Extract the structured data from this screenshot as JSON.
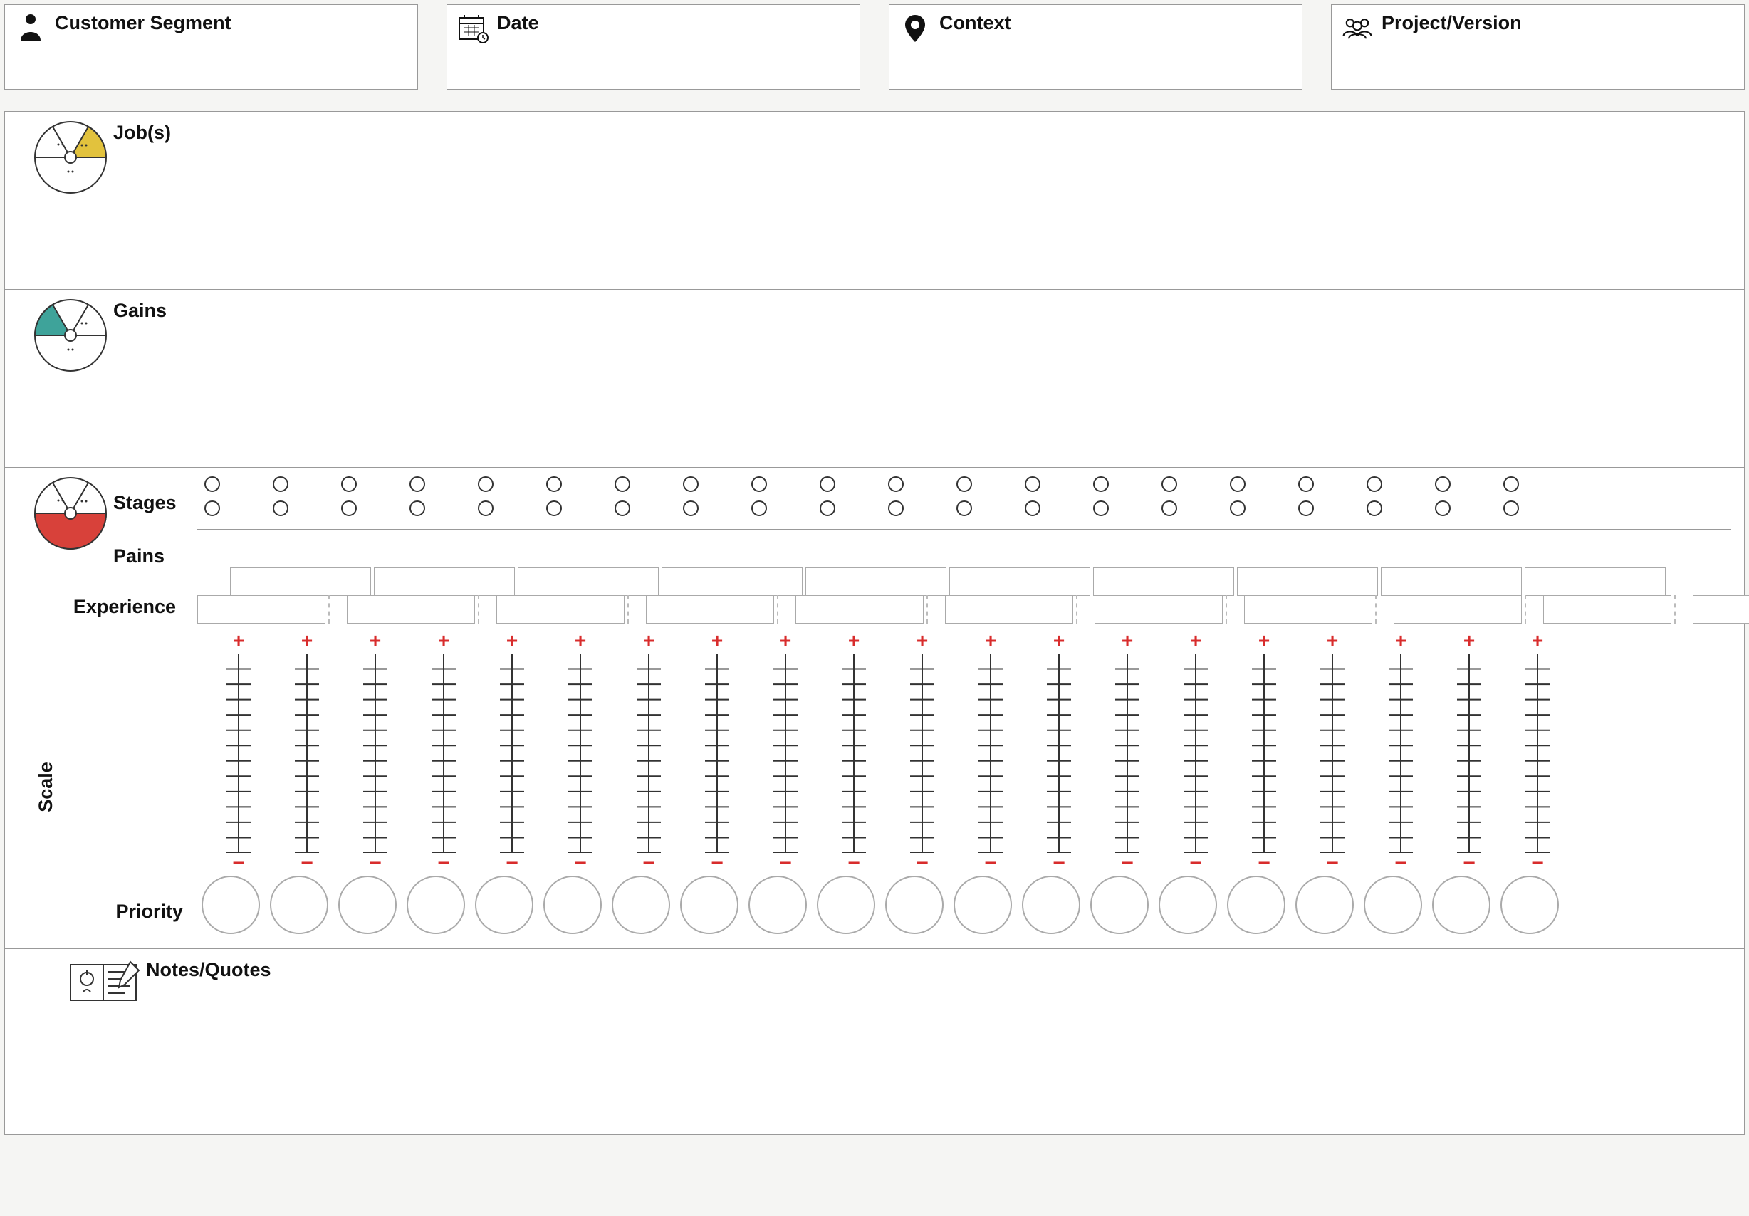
{
  "header": {
    "customer_segment": "Customer Segment",
    "date": "Date",
    "context": "Context",
    "project_version": "Project/Version"
  },
  "panels": {
    "jobs": "Job(s)",
    "gains": "Gains",
    "stages": "Stages",
    "pains": "Pains",
    "experience": "Experience",
    "scale": "Scale",
    "priority": "Priority",
    "notes": "Notes/Quotes"
  },
  "stages_columns": 20,
  "stages_radio_rows": 2,
  "experience_top_boxes": 10,
  "experience_bottom_boxes": 11,
  "scale_columns": 20,
  "scale_ticks": 14,
  "scale_top_symbol": "+",
  "scale_bottom_symbol": "−",
  "priority_circles": 20,
  "colors": {
    "jobs_accent": "#e2c23d",
    "gains_accent": "#3ea39a",
    "pains_accent": "#d8413a",
    "symbol_red": "#d82c2c"
  }
}
